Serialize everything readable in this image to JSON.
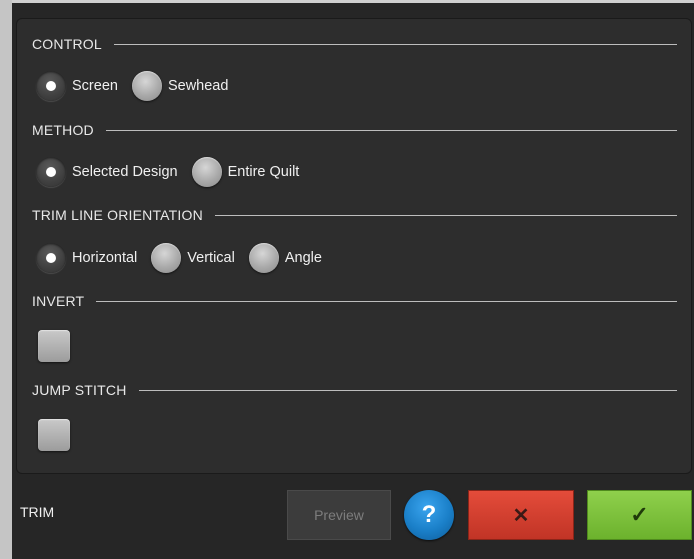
{
  "sections": {
    "control": {
      "title": "CONTROL",
      "options": [
        {
          "label": "Screen",
          "selected": true
        },
        {
          "label": "Sewhead",
          "selected": false
        }
      ]
    },
    "method": {
      "title": "METHOD",
      "options": [
        {
          "label": "Selected Design",
          "selected": true
        },
        {
          "label": "Entire Quilt",
          "selected": false
        }
      ]
    },
    "orientation": {
      "title": "TRIM LINE ORIENTATION",
      "options": [
        {
          "label": "Horizontal",
          "selected": true
        },
        {
          "label": "Vertical",
          "selected": false
        },
        {
          "label": "Angle",
          "selected": false
        }
      ]
    },
    "invert": {
      "title": "INVERT",
      "checked": false
    },
    "jump_stitch": {
      "title": "JUMP STITCH",
      "checked": false
    }
  },
  "footer": {
    "title": "TRIM",
    "preview_label": "Preview",
    "help_glyph": "?",
    "cancel_glyph": "✕",
    "ok_glyph": "✓"
  },
  "icons": {
    "help": "help-icon",
    "cancel": "close-icon",
    "ok": "check-icon"
  },
  "colors": {
    "background": "#262626",
    "panel": "#2d2d2d",
    "cancel": "#d43f2f",
    "ok": "#7dc23c",
    "help": "#1a7fc8"
  }
}
